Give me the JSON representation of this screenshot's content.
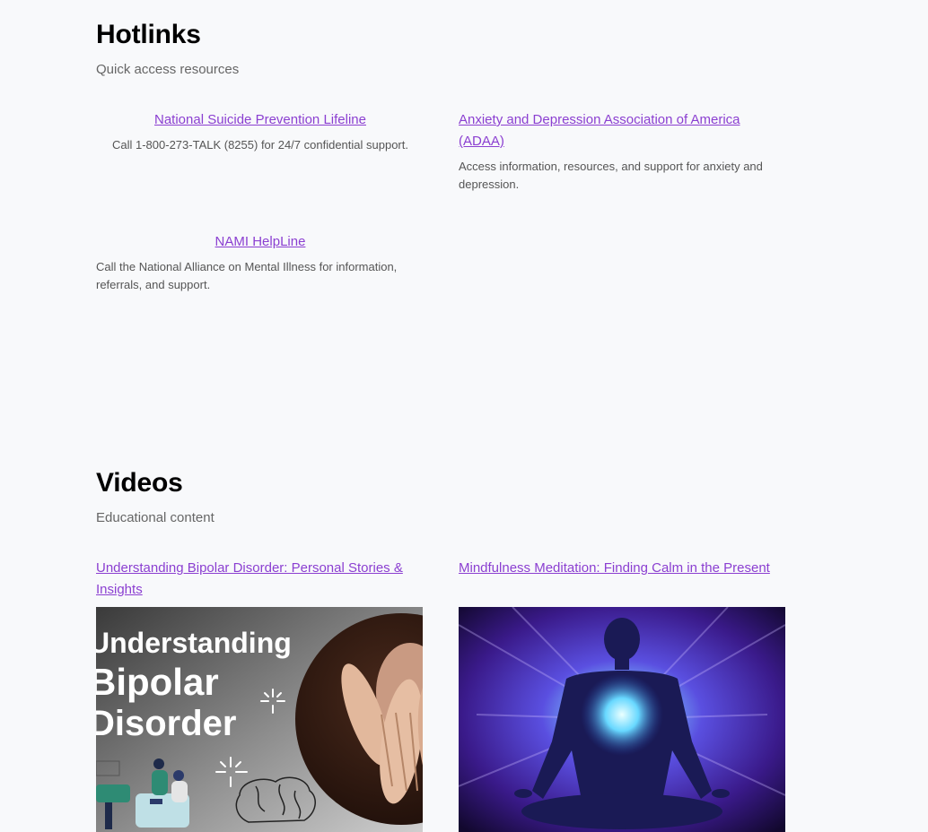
{
  "hotlinks": {
    "title": "Hotlinks",
    "subtitle": "Quick access resources",
    "items": [
      {
        "label": "National Suicide Prevention Lifeline",
        "description": "Call 1-800-273-TALK (8255) for 24/7 confidential support."
      },
      {
        "label": "Anxiety and Depression Association of America (ADAA)",
        "description": "Access information, resources, and support for anxiety and depression."
      },
      {
        "label": "NAMI HelpLine",
        "description": "Call the National Alliance on Mental Illness for information, referrals, and support."
      }
    ]
  },
  "videos": {
    "title": "Videos",
    "subtitle": "Educational content",
    "items": [
      {
        "label": "Understanding Bipolar Disorder: Personal Stories & Insights",
        "thumbnail_text": [
          "Understanding",
          "Bipolar",
          "Disorder"
        ]
      },
      {
        "label": "Mindfulness Meditation: Finding Calm in the Present"
      }
    ]
  },
  "colors": {
    "link": "#8b3fd1",
    "background": "#f8f9fb"
  }
}
